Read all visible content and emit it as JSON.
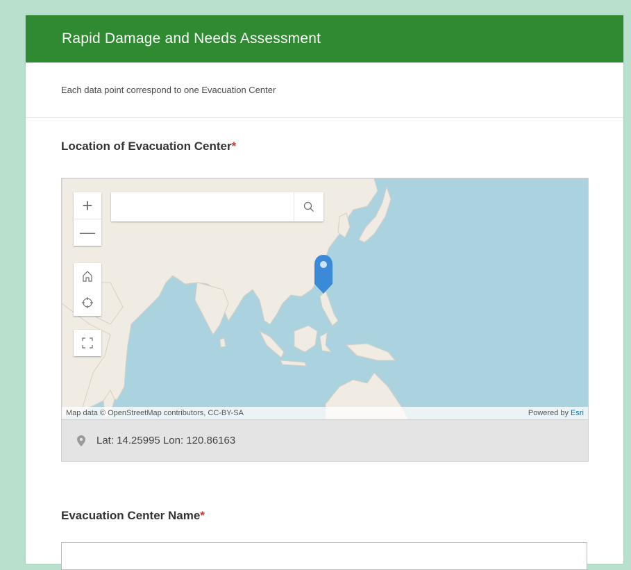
{
  "header": {
    "title": "Rapid Damage and Needs Assessment"
  },
  "description": "Each data point correspond to one Evacuation Center",
  "questions": {
    "location": {
      "label": "Location of Evacuation Center",
      "required_mark": "*"
    },
    "name": {
      "label": "Evacuation Center Name",
      "required_mark": "*",
      "value": ""
    }
  },
  "map": {
    "zoom_in": "+",
    "zoom_out": "—",
    "search_value": "",
    "search_icon": "search-icon",
    "home_icon": "home-icon",
    "locate_icon": "locate-icon",
    "fullscreen_icon": "fullscreen-icon",
    "attribution_left": "Map data © OpenStreetMap contributors, CC-BY-SA",
    "attribution_powered": "Powered by ",
    "attribution_esri": "Esri",
    "coordinates": "Lat: 14.25995  Lon: 120.86163"
  },
  "colors": {
    "header": "#2f8a32",
    "page_background": "#b9e0cc",
    "water": "#aad3df",
    "land": "#f0ece3",
    "pin": "#3b8ad8",
    "required": "#d0342c"
  }
}
